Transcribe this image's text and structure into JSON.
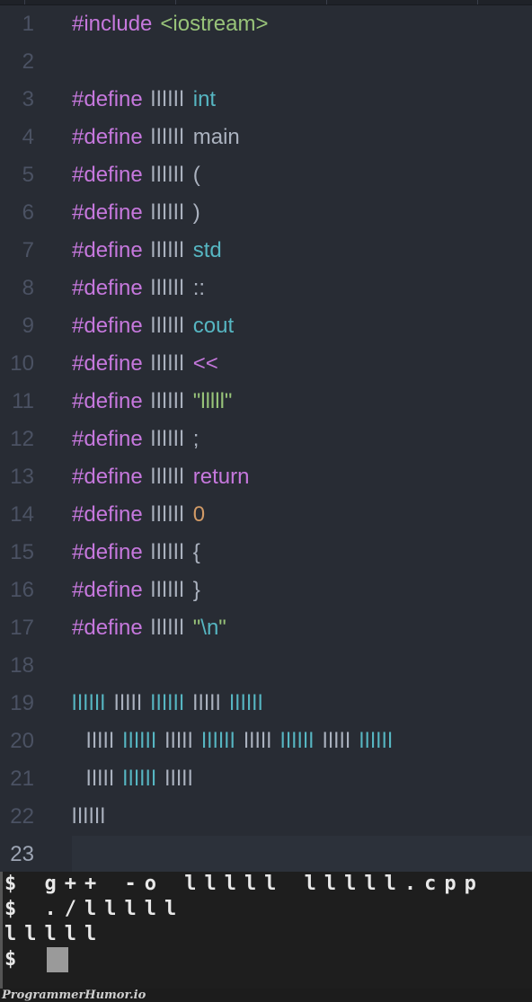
{
  "tabs": [
    "",
    "",
    "",
    ""
  ],
  "editor": {
    "current_line": 23,
    "lines": [
      {
        "n": "1",
        "tokens": [
          {
            "t": "#include",
            "c": "kw"
          },
          {
            "t": "<iostream>",
            "c": "str"
          }
        ]
      },
      {
        "n": "2",
        "tokens": []
      },
      {
        "n": "3",
        "tokens": [
          {
            "t": "#define",
            "c": "kw"
          },
          {
            "t": "llllll",
            "c": "plain ident"
          },
          {
            "t": "int",
            "c": "cyan"
          }
        ]
      },
      {
        "n": "4",
        "tokens": [
          {
            "t": "#define",
            "c": "kw"
          },
          {
            "t": "llllll",
            "c": "plain ident"
          },
          {
            "t": "main",
            "c": "plain"
          }
        ]
      },
      {
        "n": "5",
        "tokens": [
          {
            "t": "#define",
            "c": "kw"
          },
          {
            "t": "llllll",
            "c": "plain ident"
          },
          {
            "t": "(",
            "c": "plain"
          }
        ]
      },
      {
        "n": "6",
        "tokens": [
          {
            "t": "#define",
            "c": "kw"
          },
          {
            "t": "llllll",
            "c": "plain ident"
          },
          {
            "t": ")",
            "c": "plain"
          }
        ]
      },
      {
        "n": "7",
        "tokens": [
          {
            "t": "#define",
            "c": "kw"
          },
          {
            "t": "llllll",
            "c": "plain ident"
          },
          {
            "t": "std",
            "c": "cyan"
          }
        ]
      },
      {
        "n": "8",
        "tokens": [
          {
            "t": "#define",
            "c": "kw"
          },
          {
            "t": "llllll",
            "c": "plain ident"
          },
          {
            "t": "::",
            "c": "plain"
          }
        ]
      },
      {
        "n": "9",
        "tokens": [
          {
            "t": "#define",
            "c": "kw"
          },
          {
            "t": "llllll",
            "c": "plain ident"
          },
          {
            "t": "cout",
            "c": "cyan"
          }
        ]
      },
      {
        "n": "10",
        "tokens": [
          {
            "t": "#define",
            "c": "kw"
          },
          {
            "t": "llllll",
            "c": "plain ident"
          },
          {
            "t": "<<",
            "c": "kw"
          }
        ]
      },
      {
        "n": "11",
        "tokens": [
          {
            "t": "#define",
            "c": "kw"
          },
          {
            "t": "llllll",
            "c": "plain ident"
          },
          {
            "t": "\"lllll\"",
            "c": "str"
          }
        ]
      },
      {
        "n": "12",
        "tokens": [
          {
            "t": "#define",
            "c": "kw"
          },
          {
            "t": "llllll",
            "c": "plain ident"
          },
          {
            "t": ";",
            "c": "plain"
          }
        ]
      },
      {
        "n": "13",
        "tokens": [
          {
            "t": "#define",
            "c": "kw"
          },
          {
            "t": "llllll",
            "c": "plain ident"
          },
          {
            "t": "return",
            "c": "kw"
          }
        ]
      },
      {
        "n": "14",
        "tokens": [
          {
            "t": "#define",
            "c": "kw"
          },
          {
            "t": "llllll",
            "c": "plain ident"
          },
          {
            "t": "0",
            "c": "num"
          }
        ]
      },
      {
        "n": "15",
        "tokens": [
          {
            "t": "#define",
            "c": "kw"
          },
          {
            "t": "llllll",
            "c": "plain ident"
          },
          {
            "t": "{",
            "c": "plain"
          }
        ]
      },
      {
        "n": "16",
        "tokens": [
          {
            "t": "#define",
            "c": "kw"
          },
          {
            "t": "llllll",
            "c": "plain ident"
          },
          {
            "t": "}",
            "c": "plain"
          }
        ]
      },
      {
        "n": "17",
        "tokens": [
          {
            "t": "#define",
            "c": "kw"
          },
          {
            "t": "llllll",
            "c": "plain ident"
          },
          {
            "t": "\"\\n\"",
            "c": "str",
            "split": [
              {
                "t": "\"",
                "c": "str"
              },
              {
                "t": "\\n",
                "c": "cyan"
              },
              {
                "t": "\"",
                "c": "str"
              }
            ]
          }
        ]
      },
      {
        "n": "18",
        "tokens": []
      },
      {
        "n": "19",
        "tokens": [
          {
            "t": "llllll",
            "c": "cyan ident"
          },
          {
            "t": "lllll",
            "c": "plain ident"
          },
          {
            "t": "llllll",
            "c": "cyan ident"
          },
          {
            "t": "lllll",
            "c": "plain ident"
          },
          {
            "t": "llllll",
            "c": "cyan ident"
          }
        ]
      },
      {
        "n": "20",
        "indent": true,
        "tokens": [
          {
            "t": "lllll",
            "c": "plain ident"
          },
          {
            "t": "llllll",
            "c": "cyan ident"
          },
          {
            "t": "lllll",
            "c": "plain ident"
          },
          {
            "t": "llllll",
            "c": "cyan ident"
          },
          {
            "t": "lllll",
            "c": "plain ident"
          },
          {
            "t": "llllll",
            "c": "cyan ident"
          },
          {
            "t": "lllll",
            "c": "plain ident"
          },
          {
            "t": "llllll",
            "c": "cyan ident"
          }
        ]
      },
      {
        "n": "21",
        "indent": true,
        "tokens": [
          {
            "t": "lllll",
            "c": "plain ident"
          },
          {
            "t": "llllll",
            "c": "cyan ident"
          },
          {
            "t": "lllll",
            "c": "plain ident"
          }
        ]
      },
      {
        "n": "22",
        "tokens": [
          {
            "t": "llllll",
            "c": "plain ident"
          }
        ]
      },
      {
        "n": "23",
        "tokens": []
      }
    ]
  },
  "terminal": {
    "lines": [
      "$ g++ -o lllll lllll.cpp",
      "$ ./lllll",
      "lllll",
      "$ "
    ]
  },
  "watermark": "ProgrammerHumor.io",
  "colors": {
    "background": "#282c34",
    "keyword": "#c678dd",
    "string": "#98c379",
    "cyan": "#56b6c2",
    "number": "#d19a66",
    "plain": "#abb2bf",
    "terminal_bg": "#1e1e1e"
  }
}
